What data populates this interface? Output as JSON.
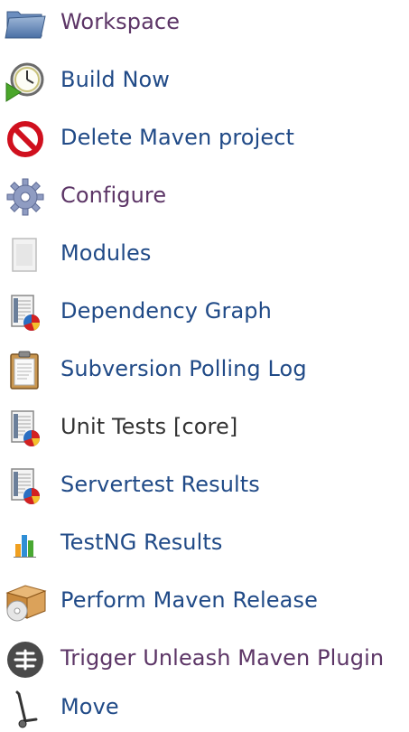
{
  "colors": {
    "link": "#204a87",
    "visited_link": "#5c3566",
    "plain_text": "#333333"
  },
  "tasks": [
    {
      "label": "Workspace",
      "icon": "folder-icon",
      "style": "visited"
    },
    {
      "label": "Build Now",
      "icon": "clock-play-icon",
      "style": "link"
    },
    {
      "label": "Delete Maven project",
      "icon": "no-entry-icon",
      "style": "link"
    },
    {
      "label": "Configure",
      "icon": "gear-icon",
      "style": "visited"
    },
    {
      "label": "Modules",
      "icon": "document-icon",
      "style": "link"
    },
    {
      "label": "Dependency Graph",
      "icon": "report-chart-icon",
      "style": "link"
    },
    {
      "label": "Subversion Polling Log",
      "icon": "clipboard-icon",
      "style": "link"
    },
    {
      "label": "Unit Tests [core]",
      "icon": "report-chart-icon",
      "style": "plain"
    },
    {
      "label": "Servertest Results",
      "icon": "report-chart-icon",
      "style": "link"
    },
    {
      "label": "TestNG Results",
      "icon": "bar-chart-icon",
      "style": "link"
    },
    {
      "label": "Perform Maven Release",
      "icon": "package-disc-icon",
      "style": "link"
    },
    {
      "label": "Trigger Unleash Maven Plugin",
      "icon": "unleash-logo-icon",
      "style": "visited"
    },
    {
      "label": "Move",
      "icon": "hand-truck-icon",
      "style": "link"
    }
  ]
}
